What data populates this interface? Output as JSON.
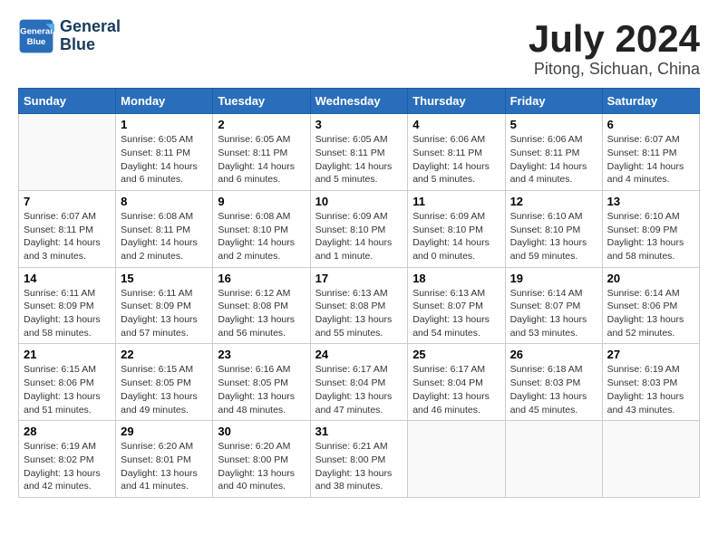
{
  "header": {
    "logo_line1": "General",
    "logo_line2": "Blue",
    "month": "July 2024",
    "location": "Pitong, Sichuan, China"
  },
  "columns": [
    "Sunday",
    "Monday",
    "Tuesday",
    "Wednesday",
    "Thursday",
    "Friday",
    "Saturday"
  ],
  "weeks": [
    [
      {
        "day": "",
        "info": ""
      },
      {
        "day": "1",
        "info": "Sunrise: 6:05 AM\nSunset: 8:11 PM\nDaylight: 14 hours\nand 6 minutes."
      },
      {
        "day": "2",
        "info": "Sunrise: 6:05 AM\nSunset: 8:11 PM\nDaylight: 14 hours\nand 6 minutes."
      },
      {
        "day": "3",
        "info": "Sunrise: 6:05 AM\nSunset: 8:11 PM\nDaylight: 14 hours\nand 5 minutes."
      },
      {
        "day": "4",
        "info": "Sunrise: 6:06 AM\nSunset: 8:11 PM\nDaylight: 14 hours\nand 5 minutes."
      },
      {
        "day": "5",
        "info": "Sunrise: 6:06 AM\nSunset: 8:11 PM\nDaylight: 14 hours\nand 4 minutes."
      },
      {
        "day": "6",
        "info": "Sunrise: 6:07 AM\nSunset: 8:11 PM\nDaylight: 14 hours\nand 4 minutes."
      }
    ],
    [
      {
        "day": "7",
        "info": "Sunrise: 6:07 AM\nSunset: 8:11 PM\nDaylight: 14 hours\nand 3 minutes."
      },
      {
        "day": "8",
        "info": "Sunrise: 6:08 AM\nSunset: 8:11 PM\nDaylight: 14 hours\nand 2 minutes."
      },
      {
        "day": "9",
        "info": "Sunrise: 6:08 AM\nSunset: 8:10 PM\nDaylight: 14 hours\nand 2 minutes."
      },
      {
        "day": "10",
        "info": "Sunrise: 6:09 AM\nSunset: 8:10 PM\nDaylight: 14 hours\nand 1 minute."
      },
      {
        "day": "11",
        "info": "Sunrise: 6:09 AM\nSunset: 8:10 PM\nDaylight: 14 hours\nand 0 minutes."
      },
      {
        "day": "12",
        "info": "Sunrise: 6:10 AM\nSunset: 8:10 PM\nDaylight: 13 hours\nand 59 minutes."
      },
      {
        "day": "13",
        "info": "Sunrise: 6:10 AM\nSunset: 8:09 PM\nDaylight: 13 hours\nand 58 minutes."
      }
    ],
    [
      {
        "day": "14",
        "info": "Sunrise: 6:11 AM\nSunset: 8:09 PM\nDaylight: 13 hours\nand 58 minutes."
      },
      {
        "day": "15",
        "info": "Sunrise: 6:11 AM\nSunset: 8:09 PM\nDaylight: 13 hours\nand 57 minutes."
      },
      {
        "day": "16",
        "info": "Sunrise: 6:12 AM\nSunset: 8:08 PM\nDaylight: 13 hours\nand 56 minutes."
      },
      {
        "day": "17",
        "info": "Sunrise: 6:13 AM\nSunset: 8:08 PM\nDaylight: 13 hours\nand 55 minutes."
      },
      {
        "day": "18",
        "info": "Sunrise: 6:13 AM\nSunset: 8:07 PM\nDaylight: 13 hours\nand 54 minutes."
      },
      {
        "day": "19",
        "info": "Sunrise: 6:14 AM\nSunset: 8:07 PM\nDaylight: 13 hours\nand 53 minutes."
      },
      {
        "day": "20",
        "info": "Sunrise: 6:14 AM\nSunset: 8:06 PM\nDaylight: 13 hours\nand 52 minutes."
      }
    ],
    [
      {
        "day": "21",
        "info": "Sunrise: 6:15 AM\nSunset: 8:06 PM\nDaylight: 13 hours\nand 51 minutes."
      },
      {
        "day": "22",
        "info": "Sunrise: 6:15 AM\nSunset: 8:05 PM\nDaylight: 13 hours\nand 49 minutes."
      },
      {
        "day": "23",
        "info": "Sunrise: 6:16 AM\nSunset: 8:05 PM\nDaylight: 13 hours\nand 48 minutes."
      },
      {
        "day": "24",
        "info": "Sunrise: 6:17 AM\nSunset: 8:04 PM\nDaylight: 13 hours\nand 47 minutes."
      },
      {
        "day": "25",
        "info": "Sunrise: 6:17 AM\nSunset: 8:04 PM\nDaylight: 13 hours\nand 46 minutes."
      },
      {
        "day": "26",
        "info": "Sunrise: 6:18 AM\nSunset: 8:03 PM\nDaylight: 13 hours\nand 45 minutes."
      },
      {
        "day": "27",
        "info": "Sunrise: 6:19 AM\nSunset: 8:03 PM\nDaylight: 13 hours\nand 43 minutes."
      }
    ],
    [
      {
        "day": "28",
        "info": "Sunrise: 6:19 AM\nSunset: 8:02 PM\nDaylight: 13 hours\nand 42 minutes."
      },
      {
        "day": "29",
        "info": "Sunrise: 6:20 AM\nSunset: 8:01 PM\nDaylight: 13 hours\nand 41 minutes."
      },
      {
        "day": "30",
        "info": "Sunrise: 6:20 AM\nSunset: 8:00 PM\nDaylight: 13 hours\nand 40 minutes."
      },
      {
        "day": "31",
        "info": "Sunrise: 6:21 AM\nSunset: 8:00 PM\nDaylight: 13 hours\nand 38 minutes."
      },
      {
        "day": "",
        "info": ""
      },
      {
        "day": "",
        "info": ""
      },
      {
        "day": "",
        "info": ""
      }
    ]
  ]
}
